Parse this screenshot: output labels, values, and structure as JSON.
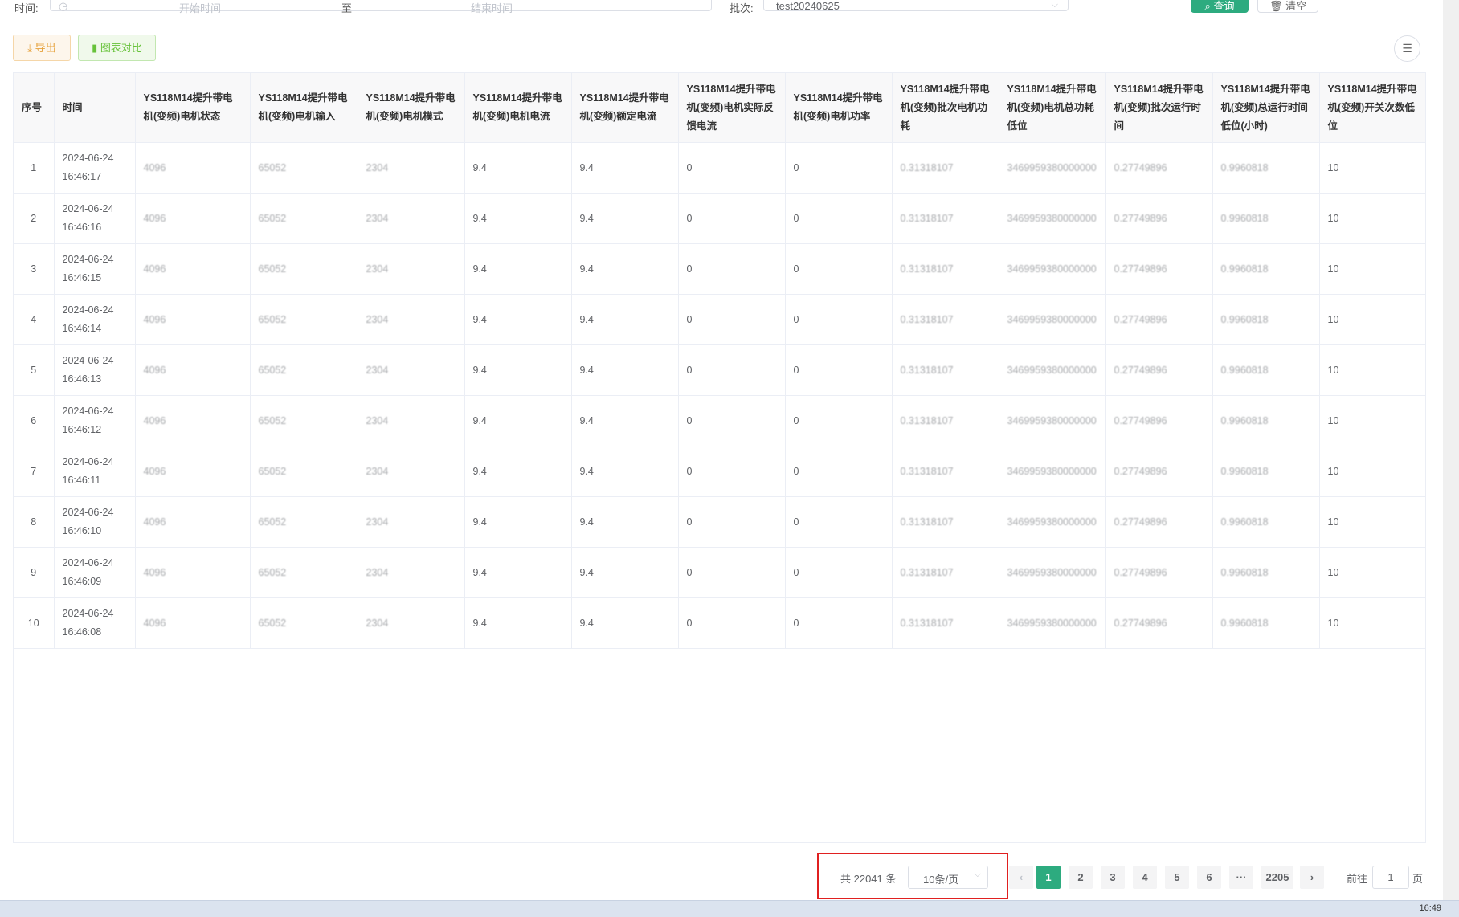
{
  "filter": {
    "time_label": "时间:",
    "start_placeholder": "开始时间",
    "range_separator": "至",
    "end_placeholder": "结束时间",
    "batch_label": "批次:",
    "batch_value": "test20240625",
    "query_label": "查询",
    "clear_label": "清空"
  },
  "toolbar": {
    "export_label": "导出",
    "chart_compare_label": "图表对比"
  },
  "table": {
    "columns": [
      "序号",
      "时间",
      "YS118M14提升带电机(变频)电机状态",
      "YS118M14提升带电机(变频)电机输入",
      "YS118M14提升带电机(变频)电机模式",
      "YS118M14提升带电机(变频)电机电流",
      "YS118M14提升带电机(变频)额定电流",
      "YS118M14提升带电机(变频)电机实际反馈电流",
      "YS118M14提升带电机(变频)电机功率",
      "YS118M14提升带电机(变频)批次电机功耗",
      "YS118M14提升带电机(变频)电机总功耗低位",
      "YS118M14提升带电机(变频)批次运行时间",
      "YS118M14提升带电机(变频)总运行时间低位(小时)",
      "YS118M14提升带电机(变频)开关次数低位"
    ],
    "rows": [
      [
        "1",
        "2024-06-24 16:46:17",
        "4096",
        "65052",
        "2304",
        "9.4",
        "9.4",
        "0",
        "0",
        "0.31318107",
        "3469959380000000",
        "0.27749896",
        "0.9960818",
        "10"
      ],
      [
        "2",
        "2024-06-24 16:46:16",
        "4096",
        "65052",
        "2304",
        "9.4",
        "9.4",
        "0",
        "0",
        "0.31318107",
        "3469959380000000",
        "0.27749896",
        "0.9960818",
        "10"
      ],
      [
        "3",
        "2024-06-24 16:46:15",
        "4096",
        "65052",
        "2304",
        "9.4",
        "9.4",
        "0",
        "0",
        "0.31318107",
        "3469959380000000",
        "0.27749896",
        "0.9960818",
        "10"
      ],
      [
        "4",
        "2024-06-24 16:46:14",
        "4096",
        "65052",
        "2304",
        "9.4",
        "9.4",
        "0",
        "0",
        "0.31318107",
        "3469959380000000",
        "0.27749896",
        "0.9960818",
        "10"
      ],
      [
        "5",
        "2024-06-24 16:46:13",
        "4096",
        "65052",
        "2304",
        "9.4",
        "9.4",
        "0",
        "0",
        "0.31318107",
        "3469959380000000",
        "0.27749896",
        "0.9960818",
        "10"
      ],
      [
        "6",
        "2024-06-24 16:46:12",
        "4096",
        "65052",
        "2304",
        "9.4",
        "9.4",
        "0",
        "0",
        "0.31318107",
        "3469959380000000",
        "0.27749896",
        "0.9960818",
        "10"
      ],
      [
        "7",
        "2024-06-24 16:46:11",
        "4096",
        "65052",
        "2304",
        "9.4",
        "9.4",
        "0",
        "0",
        "0.31318107",
        "3469959380000000",
        "0.27749896",
        "0.9960818",
        "10"
      ],
      [
        "8",
        "2024-06-24 16:46:10",
        "4096",
        "65052",
        "2304",
        "9.4",
        "9.4",
        "0",
        "0",
        "0.31318107",
        "3469959380000000",
        "0.27749896",
        "0.9960818",
        "10"
      ],
      [
        "9",
        "2024-06-24 16:46:09",
        "4096",
        "65052",
        "2304",
        "9.4",
        "9.4",
        "0",
        "0",
        "0.31318107",
        "3469959380000000",
        "0.27749896",
        "0.9960818",
        "10"
      ],
      [
        "10",
        "2024-06-24 16:46:08",
        "4096",
        "65052",
        "2304",
        "9.4",
        "9.4",
        "0",
        "0",
        "0.31318107",
        "3469959380000000",
        "0.27749896",
        "0.9960818",
        "10"
      ]
    ]
  },
  "pagination": {
    "total_text": "共 22041 条",
    "page_size": "10条/页",
    "pages": [
      "1",
      "2",
      "3",
      "4",
      "5",
      "6",
      "···",
      "2205"
    ],
    "current_page": "1",
    "goto_label": "前往",
    "goto_value": "1",
    "page_suffix": "页"
  },
  "taskbar": {
    "clock": "16:49"
  }
}
